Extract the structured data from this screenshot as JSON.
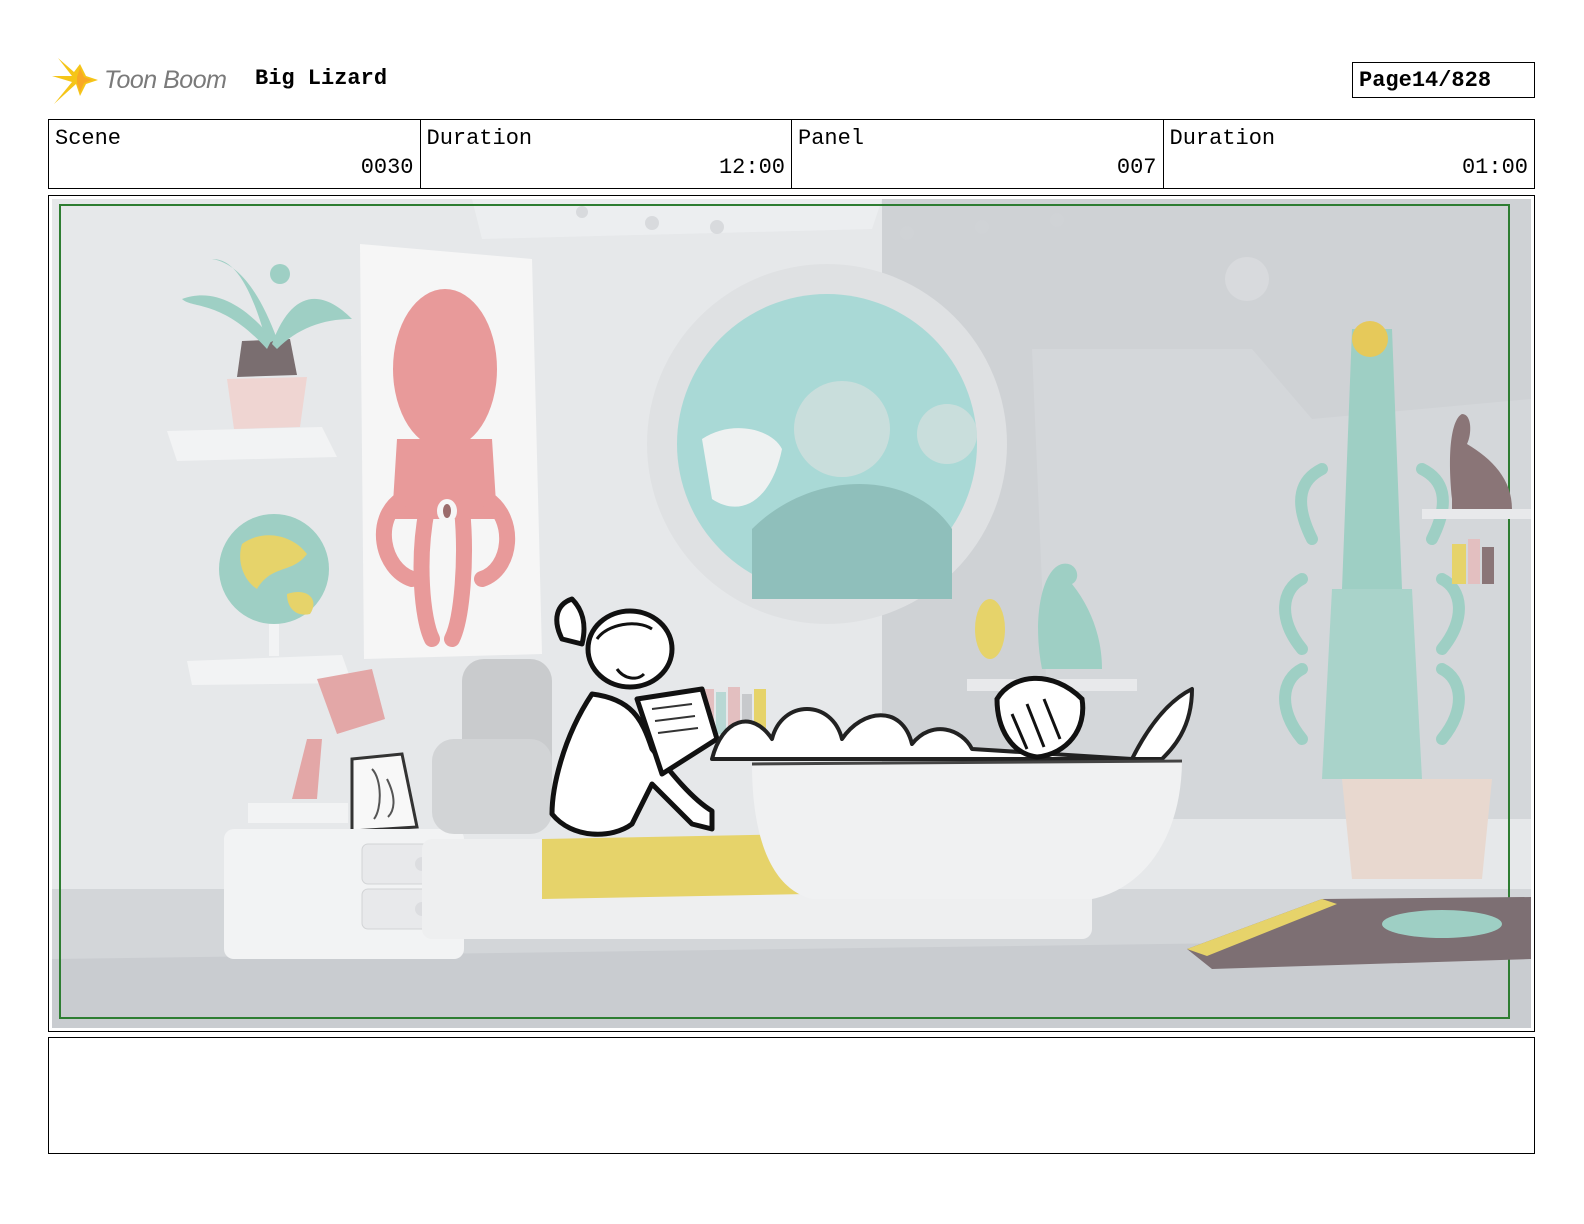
{
  "header": {
    "logo_text": "Toon Boom",
    "project_title": "Big Lizard",
    "page_label": "Page",
    "page_value": "14/828"
  },
  "info": [
    {
      "label": "Scene",
      "value": "0030"
    },
    {
      "label": "Duration",
      "value": "12:00"
    },
    {
      "label": "Panel",
      "value": "007"
    },
    {
      "label": "Duration",
      "value": "01:00"
    }
  ],
  "colors": {
    "logo_accent": "#f5c518",
    "safe_frame": "#2e7d32",
    "wall": "#e4e6e8",
    "octopus": "#e89a9a",
    "window_sea": "#a9d9d6",
    "blanket": "#e6d36a",
    "plant": "#9ecfc4"
  },
  "icons": {
    "logo": "toon-boom-star-icon"
  }
}
